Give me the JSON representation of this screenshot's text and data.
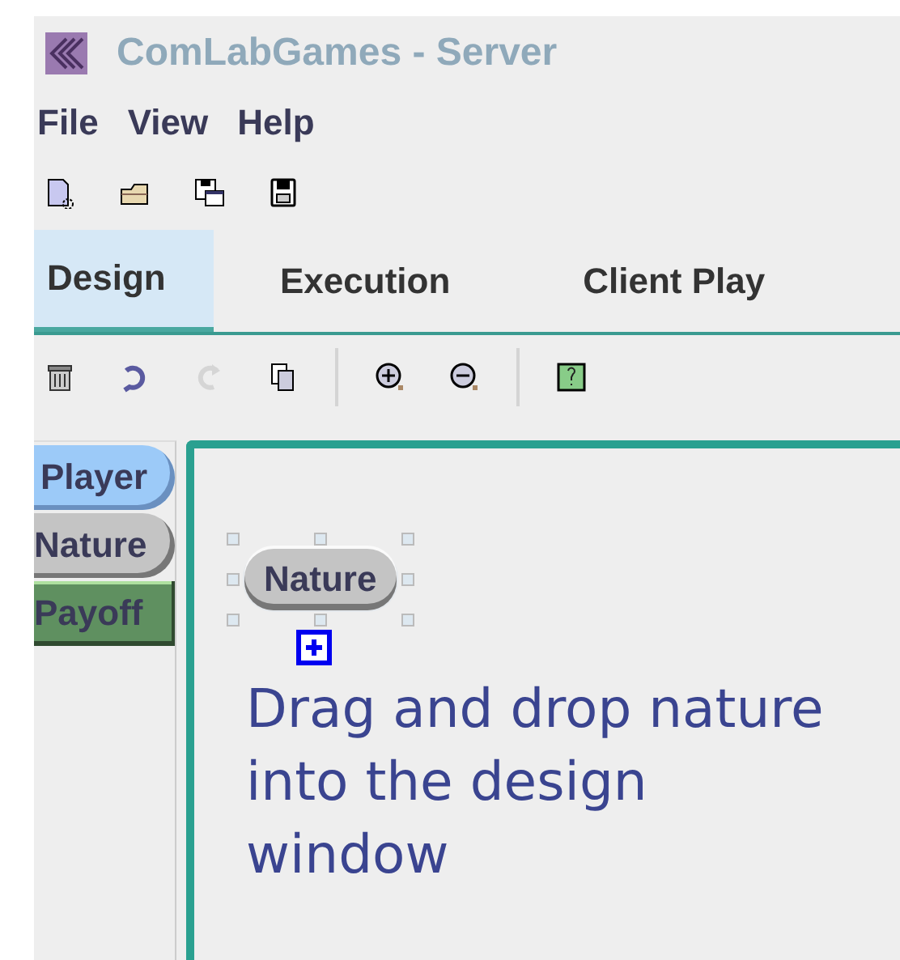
{
  "window": {
    "title": "ComLabGames - Server"
  },
  "menu": [
    "File",
    "View",
    "Help"
  ],
  "file_toolbar": [
    {
      "kind": "new",
      "disabled": false
    },
    {
      "kind": "open",
      "disabled": false
    },
    {
      "kind": "saveas",
      "disabled": false
    },
    {
      "kind": "save",
      "disabled": false
    }
  ],
  "tabs": [
    {
      "label": "Design",
      "selected": true
    },
    {
      "label": "Execution",
      "selected": false
    },
    {
      "label": "Client Play",
      "selected": false
    }
  ],
  "edit_toolbar": [
    {
      "kind": "delete",
      "disabled": false
    },
    {
      "kind": "undo",
      "disabled": false
    },
    {
      "kind": "redo",
      "disabled": true
    },
    {
      "kind": "copy",
      "disabled": false
    },
    {
      "kind": "sep"
    },
    {
      "kind": "zoomin",
      "disabled": false
    },
    {
      "kind": "zoomout",
      "disabled": false
    },
    {
      "kind": "sep"
    },
    {
      "kind": "help",
      "disabled": false
    }
  ],
  "palette": [
    {
      "label": "Player",
      "kind": "player"
    },
    {
      "label": "Nature",
      "kind": "nature"
    },
    {
      "label": "Payoff",
      "kind": "payoff"
    }
  ],
  "canvas": {
    "node": {
      "label": "Nature",
      "selected": true
    },
    "caption": "Drag and drop nature into the design window"
  }
}
